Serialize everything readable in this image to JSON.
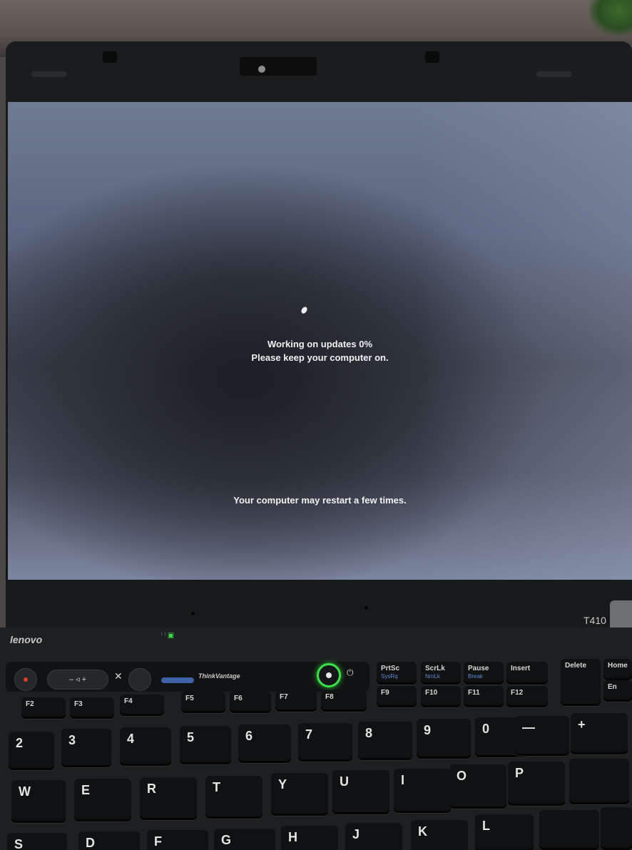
{
  "screen": {
    "line1": "Working on updates  0%",
    "line2": "Please keep your computer on.",
    "line3": "Your computer may restart a few times.",
    "progress_percent": 0
  },
  "laptop": {
    "brand": "lenovo",
    "model": "T410",
    "thinkvantage": "ThinkVantage"
  },
  "keys": {
    "prtsc": "PrtSc",
    "sysrq": "SysRq",
    "scrlk": "ScrLk",
    "numlk": "NmLk",
    "pause": "Pause",
    "break": "Break",
    "insert": "Insert",
    "delete": "Delete",
    "home": "Home",
    "end": "En",
    "f2": "F2",
    "f3": "F3",
    "f4": "F4",
    "f5": "F5",
    "f6": "F6",
    "f7": "F7",
    "f8": "F8",
    "f9": "F9",
    "f10": "F10",
    "f11": "F11",
    "f12": "F12",
    "d2": "2",
    "d3": "3",
    "d4": "4",
    "d5": "5",
    "d6": "6",
    "d7": "7",
    "d8": "8",
    "d9": "9",
    "d0": "0",
    "minus": "—",
    "plus": "+",
    "w": "W",
    "e": "E",
    "r": "R",
    "t": "T",
    "y": "Y",
    "u": "U",
    "i": "I",
    "o": "O",
    "p": "P",
    "s": "S",
    "d": "D",
    "f": "F",
    "g": "G",
    "h": "H",
    "j": "J",
    "k": "K",
    "l": "L"
  }
}
